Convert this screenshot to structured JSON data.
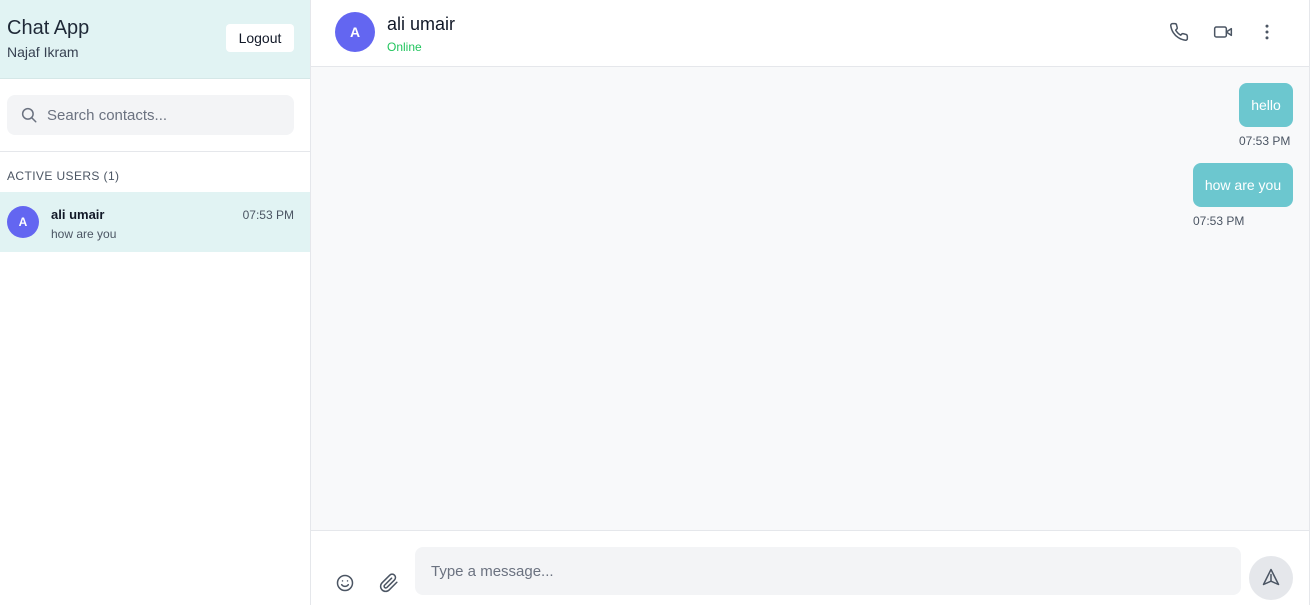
{
  "sidebar": {
    "app_title": "Chat App",
    "user_name": "Najaf Ikram",
    "logout_label": "Logout",
    "search_placeholder": "Search contacts...",
    "section_label": "ACTIVE USERS (1)",
    "contacts": [
      {
        "initial": "A",
        "name": "ali umair",
        "time": "07:53 PM",
        "preview": "how are you",
        "selected": true
      }
    ]
  },
  "chat": {
    "header": {
      "initial": "A",
      "name": "ali umair",
      "status": "Online",
      "status_color": "#22c55e",
      "actions": [
        "phone-icon",
        "video-icon",
        "more-vertical-icon"
      ]
    },
    "messages": [
      {
        "text": "hello",
        "time": "07:53 PM",
        "sender": "me"
      },
      {
        "text": "how are you",
        "time": "07:53 PM",
        "sender": "me"
      }
    ],
    "input_placeholder": "Type a message...",
    "footer_icons": [
      "emoji-icon",
      "attachment-icon",
      "send-icon"
    ]
  },
  "colors": {
    "sidebar_header_bg": "#e1f3f3",
    "avatar_bg": "#6366f1",
    "bubble_bg": "#6cc7cf",
    "online": "#22c55e"
  }
}
